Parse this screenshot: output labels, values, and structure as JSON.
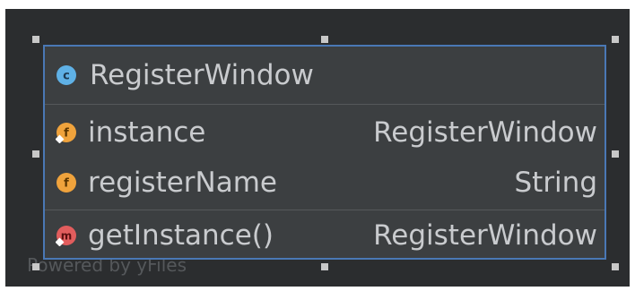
{
  "diagram": {
    "class_name": "RegisterWindow",
    "class_icon": "class-icon",
    "fields": [
      {
        "name": "instance",
        "type": "RegisterWindow",
        "icon": "static-field-icon"
      },
      {
        "name": "registerName",
        "type": "String",
        "icon": "field-icon"
      }
    ],
    "methods": [
      {
        "name": "getInstance()",
        "type": "RegisterWindow",
        "icon": "static-method-icon"
      }
    ],
    "watermark": "Powered by yFiles",
    "colors": {
      "background": "#2b2d2f",
      "node_fill": "#3c3f41",
      "selection_border": "#4a78b5",
      "text": "#c9cbce",
      "class_icon": "#5fb1e6",
      "field_icon": "#f0a33c",
      "method_icon": "#e25d5d"
    }
  }
}
